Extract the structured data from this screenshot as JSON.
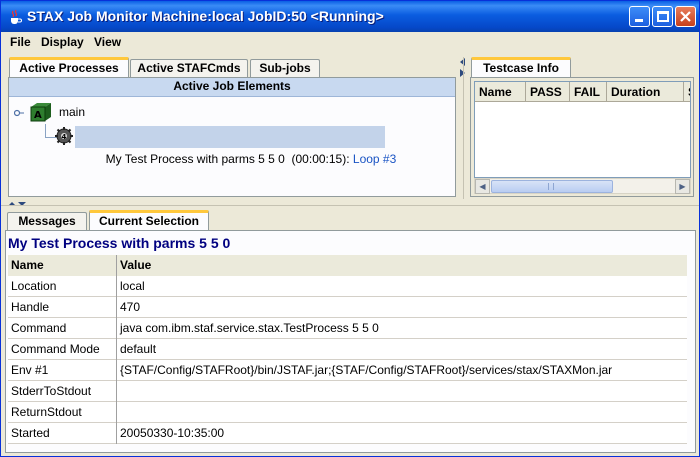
{
  "window": {
    "title": "STAX Job Monitor Machine:local JobID:50  <Running>",
    "controls": {
      "minimize": "minimize-icon",
      "maximize": "maximize-icon",
      "close": "close-icon"
    }
  },
  "menu": [
    "File",
    "Display",
    "View"
  ],
  "top_left": {
    "tabs": [
      "Active Processes",
      "Active STAFCmds",
      "Sub-jobs"
    ],
    "selected_tab": "Active Processes",
    "header": "Active Job Elements",
    "tree": {
      "root_label": "main",
      "child_label": "My Test Process with parms 5 5 0  (00:00:15): ",
      "child_loop": "Loop #3"
    }
  },
  "top_right": {
    "tab": "Testcase Info",
    "columns": [
      "Name",
      "PASS",
      "FAIL",
      "Duration",
      "S"
    ]
  },
  "bottom": {
    "tabs": [
      "Messages",
      "Current Selection"
    ],
    "selected_tab": "Current Selection",
    "selection_title": "My Test Process with parms 5 5 0",
    "columns": [
      "Name",
      "Value"
    ],
    "rows": [
      {
        "name": "Location",
        "value": "local"
      },
      {
        "name": "Handle",
        "value": "470"
      },
      {
        "name": "Command",
        "value": "java com.ibm.staf.service.stax.TestProcess 5 5 0"
      },
      {
        "name": "Command Mode",
        "value": "default"
      },
      {
        "name": "Env #1",
        "value": "{STAF/Config/STAFRoot}/bin/JSTAF.jar;{STAF/Config/STAFRoot}/services/stax/STAXMon.jar"
      },
      {
        "name": "StderrToStdout",
        "value": ""
      },
      {
        "name": "ReturnStdout",
        "value": ""
      },
      {
        "name": "Started",
        "value": "20050330-10:35:00"
      }
    ]
  },
  "colors": {
    "title_blue": "#0b5de0",
    "link_blue": "#1a54c4",
    "selection_bg": "#c3d3ea",
    "selection_title": "#000080"
  }
}
